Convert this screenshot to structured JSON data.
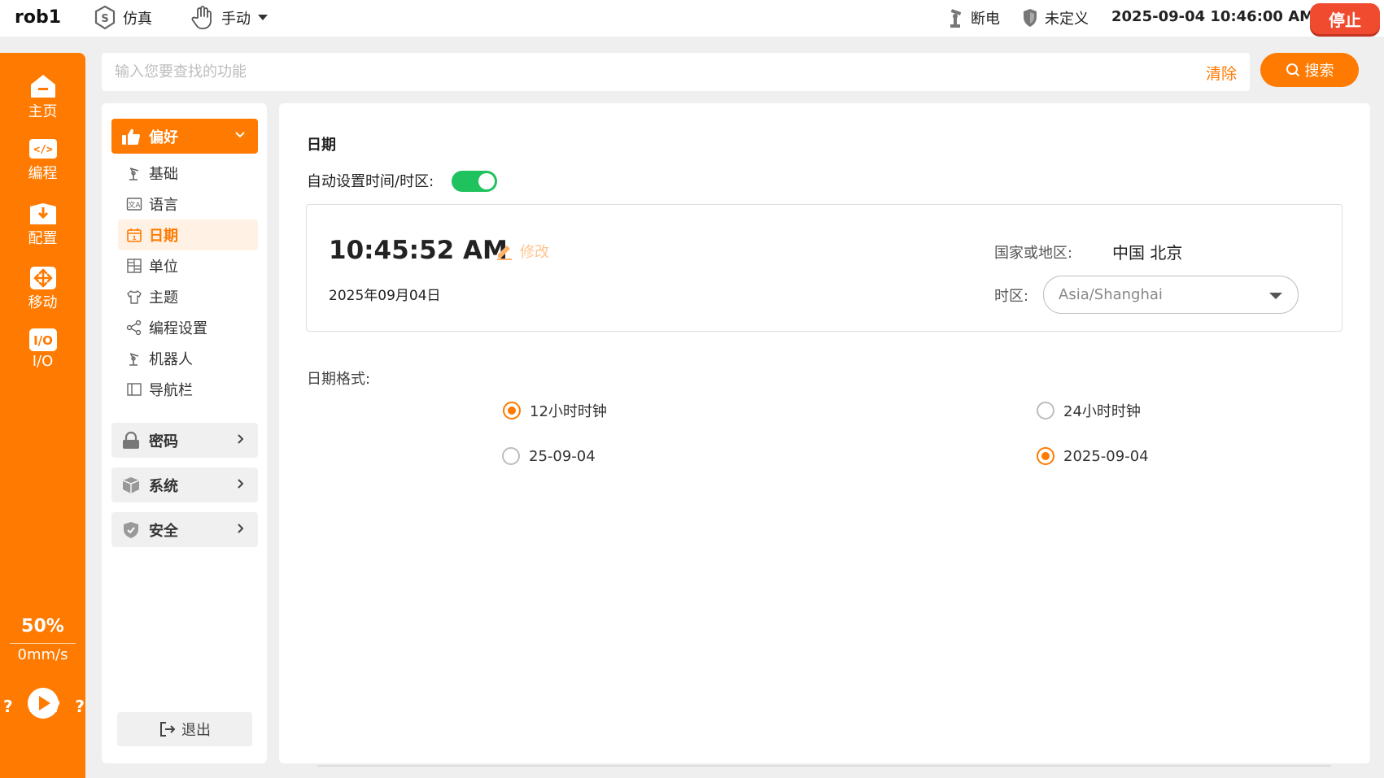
{
  "topbar": {
    "robot_name": "rob1",
    "mode_sim": "仿真",
    "mode_manual": "手动",
    "power_status": "断电",
    "safety_status": "未定义",
    "datetime": "2025-09-04 10:46:00 AM",
    "stop_label": "停止"
  },
  "nav": {
    "items": [
      {
        "label": "主页"
      },
      {
        "label": "编程"
      },
      {
        "label": "配置"
      },
      {
        "label": "移动"
      },
      {
        "label": "I/O"
      }
    ],
    "speed_percent": "50%",
    "speed_value": "0mm/s",
    "question_marks": [
      "?",
      "?",
      "?",
      "?"
    ]
  },
  "search": {
    "placeholder": "输入您要查找的功能",
    "clear_label": "清除",
    "button_label": "搜索"
  },
  "settings": {
    "groups": [
      {
        "label": "偏好",
        "expanded": true
      },
      {
        "label": "密码",
        "expanded": false
      },
      {
        "label": "系统",
        "expanded": false
      },
      {
        "label": "安全",
        "expanded": false
      }
    ],
    "sub_items": [
      {
        "label": "基础"
      },
      {
        "label": "语言"
      },
      {
        "label": "日期"
      },
      {
        "label": "单位"
      },
      {
        "label": "主题"
      },
      {
        "label": "编程设置"
      },
      {
        "label": "机器人"
      },
      {
        "label": "导航栏"
      }
    ],
    "active_sub_item": "日期",
    "logout_label": "退出"
  },
  "date_page": {
    "title": "日期",
    "auto_label": "自动设置时间/时区:",
    "auto_enabled": true,
    "time": "10:45:52 AM",
    "edit_label": "修改",
    "date": "2025年09月04日",
    "region_label": "国家或地区:",
    "region_value": "中国 北京",
    "timezone_label": "时区:",
    "timezone_value": "Asia/Shanghai",
    "format_label": "日期格式:",
    "options": {
      "clock12": {
        "label": "12小时时钟",
        "selected": true
      },
      "clock24": {
        "label": "24小时时钟",
        "selected": false
      },
      "short_date": {
        "label": "25-09-04",
        "selected": false
      },
      "long_date": {
        "label": "2025-09-04",
        "selected": true
      }
    }
  },
  "colors": {
    "accent": "#ff7a00",
    "stop": "#f04a2f",
    "toggle_on": "#1fc25c"
  }
}
